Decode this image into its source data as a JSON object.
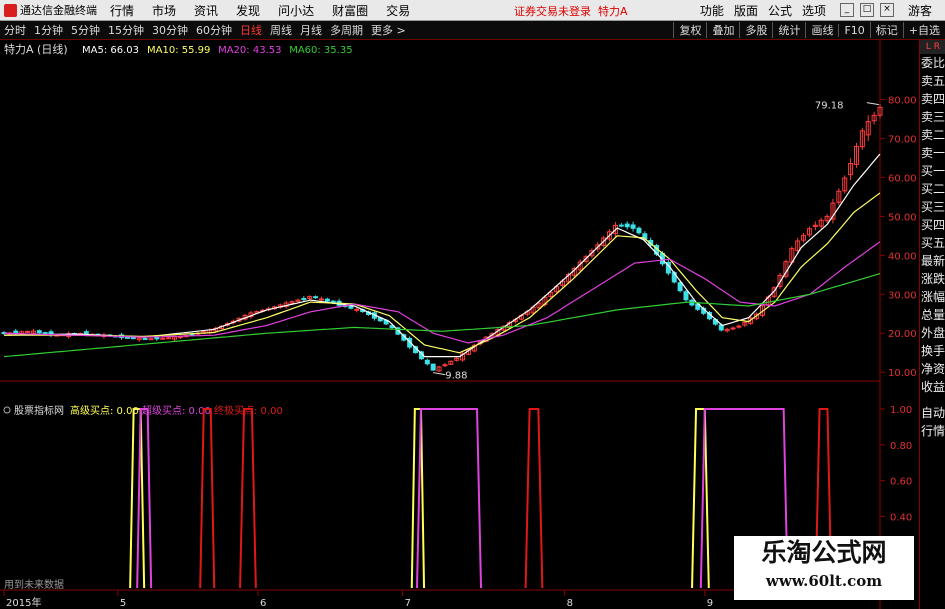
{
  "app": {
    "logo_text": "通达信金融终端",
    "menu": [
      "行情",
      "市场",
      "资讯",
      "发现",
      "问小达",
      "财富圈",
      "交易"
    ],
    "status_msg": "证券交易未登录",
    "stock_title": "特力A",
    "right_menu": [
      "功能",
      "版面",
      "公式",
      "选项"
    ],
    "guest_label": "游客",
    "win_controls": [
      "_",
      "□",
      "×"
    ]
  },
  "toolbar": {
    "periods": [
      "分时",
      "1分钟",
      "5分钟",
      "15分钟",
      "30分钟",
      "60分钟",
      "日线",
      "周线",
      "月线",
      "多周期",
      "更多 >"
    ],
    "active_period": "日线",
    "right_items": [
      "复权",
      "叠加",
      "多股",
      "统计",
      "画线",
      "F10",
      "标记",
      "+自选"
    ]
  },
  "side_tabs": [
    "L R",
    "委比",
    "卖五",
    "卖四",
    "卖三",
    "卖二",
    "卖一",
    "买一",
    "买二",
    "买三",
    "买四",
    "买五",
    "最新",
    "涨跌",
    "涨幅",
    "总量",
    "外盘",
    "换手",
    "净资",
    "收益"
  ],
  "side_tabs_bottom": [
    "自动",
    "行情"
  ],
  "watermark": {
    "title": "乐淘公式网",
    "url": "www.60lt.com"
  },
  "colors": {
    "up": "#ff3c3c",
    "down": "#3ce0e6",
    "ma5": "#ffffff",
    "ma10": "#ffff66",
    "ma20": "#e040e0",
    "ma60": "#33cc33",
    "high": "#ffff55",
    "super": "#dd44dd",
    "final": "#e01818",
    "axis": "#8a0000"
  },
  "chart_data": [
    {
      "type": "candlestick",
      "title": "特力A (日线)",
      "legend": [
        {
          "label": "MA5: 66.03",
          "color": "#ffffff"
        },
        {
          "label": "MA10: 55.99",
          "color": "#ffff66"
        },
        {
          "label": "MA20: 43.53",
          "color": "#e040e0"
        },
        {
          "label": "MA60: 35.35",
          "color": "#33cc33"
        }
      ],
      "ylim": [
        8,
        85
      ],
      "yticks": [
        10,
        20,
        30,
        40,
        50,
        60,
        70,
        80
      ],
      "ytick_labels": [
        "10.00",
        "20.00",
        "30.00",
        "40.00",
        "50.00",
        "60.00",
        "70.00",
        "80.00"
      ],
      "annotations": [
        {
          "label": "9.88",
          "value": 9.88,
          "pos": 0.49
        },
        {
          "label": "79.18",
          "value": 79.18,
          "pos": 0.985
        }
      ],
      "x_labels": [
        {
          "label": "2015年",
          "pos": 0.0
        },
        {
          "label": "5",
          "pos": 0.13
        },
        {
          "label": "6",
          "pos": 0.29
        },
        {
          "label": "7",
          "pos": 0.455
        },
        {
          "label": "8",
          "pos": 0.64
        },
        {
          "label": "9",
          "pos": 0.8
        }
      ],
      "price_path": [
        [
          0,
          20
        ],
        [
          0.03,
          20.5
        ],
        [
          0.06,
          19.5
        ],
        [
          0.09,
          20
        ],
        [
          0.12,
          19.3
        ],
        [
          0.16,
          18.5
        ],
        [
          0.2,
          19
        ],
        [
          0.24,
          21
        ],
        [
          0.28,
          25
        ],
        [
          0.32,
          27.5
        ],
        [
          0.35,
          29.5
        ],
        [
          0.38,
          27.5
        ],
        [
          0.41,
          25.5
        ],
        [
          0.44,
          22
        ],
        [
          0.47,
          15
        ],
        [
          0.49,
          10.5
        ],
        [
          0.52,
          14
        ],
        [
          0.55,
          19
        ],
        [
          0.58,
          23
        ],
        [
          0.61,
          27.5
        ],
        [
          0.64,
          34
        ],
        [
          0.67,
          41
        ],
        [
          0.7,
          48
        ],
        [
          0.72,
          47
        ],
        [
          0.74,
          42
        ],
        [
          0.76,
          35
        ],
        [
          0.78,
          28
        ],
        [
          0.8,
          25
        ],
        [
          0.82,
          20.5
        ],
        [
          0.84,
          22
        ],
        [
          0.86,
          25
        ],
        [
          0.88,
          32
        ],
        [
          0.9,
          42
        ],
        [
          0.92,
          47
        ],
        [
          0.94,
          50
        ],
        [
          0.96,
          60
        ],
        [
          0.98,
          72
        ],
        [
          1,
          78
        ]
      ],
      "ma_paths": {
        "ma5": [
          [
            0,
            19.5
          ],
          [
            0.08,
            19.8
          ],
          [
            0.16,
            19
          ],
          [
            0.24,
            21
          ],
          [
            0.3,
            26
          ],
          [
            0.35,
            28.5
          ],
          [
            0.4,
            27
          ],
          [
            0.44,
            23
          ],
          [
            0.48,
            14
          ],
          [
            0.52,
            14
          ],
          [
            0.56,
            20
          ],
          [
            0.6,
            26
          ],
          [
            0.65,
            36
          ],
          [
            0.7,
            47
          ],
          [
            0.73,
            44
          ],
          [
            0.76,
            37
          ],
          [
            0.79,
            28
          ],
          [
            0.82,
            22
          ],
          [
            0.85,
            24
          ],
          [
            0.88,
            31
          ],
          [
            0.91,
            42
          ],
          [
            0.94,
            48
          ],
          [
            0.97,
            58
          ],
          [
            1,
            66
          ]
        ],
        "ma10": [
          [
            0,
            19.5
          ],
          [
            0.08,
            19.5
          ],
          [
            0.16,
            19.2
          ],
          [
            0.24,
            20.2
          ],
          [
            0.3,
            24
          ],
          [
            0.35,
            28
          ],
          [
            0.4,
            27.5
          ],
          [
            0.44,
            24.5
          ],
          [
            0.48,
            17
          ],
          [
            0.52,
            15
          ],
          [
            0.56,
            19
          ],
          [
            0.6,
            24
          ],
          [
            0.65,
            34
          ],
          [
            0.7,
            45
          ],
          [
            0.73,
            44.5
          ],
          [
            0.76,
            39
          ],
          [
            0.79,
            31
          ],
          [
            0.82,
            24
          ],
          [
            0.85,
            23
          ],
          [
            0.88,
            28
          ],
          [
            0.91,
            37
          ],
          [
            0.94,
            43
          ],
          [
            0.97,
            51
          ],
          [
            1,
            56
          ]
        ],
        "ma20": [
          [
            0,
            20
          ],
          [
            0.08,
            19.5
          ],
          [
            0.16,
            19
          ],
          [
            0.24,
            19.5
          ],
          [
            0.3,
            22
          ],
          [
            0.35,
            25.5
          ],
          [
            0.4,
            27.5
          ],
          [
            0.45,
            25.5
          ],
          [
            0.49,
            20
          ],
          [
            0.53,
            17.5
          ],
          [
            0.57,
            19.5
          ],
          [
            0.62,
            24
          ],
          [
            0.67,
            31
          ],
          [
            0.72,
            38
          ],
          [
            0.76,
            39
          ],
          [
            0.8,
            34
          ],
          [
            0.84,
            28
          ],
          [
            0.88,
            27
          ],
          [
            0.92,
            30
          ],
          [
            0.96,
            37
          ],
          [
            1,
            43.5
          ]
        ],
        "ma60": [
          [
            0,
            14
          ],
          [
            0.1,
            16
          ],
          [
            0.2,
            18
          ],
          [
            0.3,
            20
          ],
          [
            0.4,
            21.5
          ],
          [
            0.5,
            20.5
          ],
          [
            0.6,
            22
          ],
          [
            0.7,
            26
          ],
          [
            0.78,
            28
          ],
          [
            0.85,
            27
          ],
          [
            0.92,
            30
          ],
          [
            1,
            35.3
          ]
        ]
      }
    },
    {
      "type": "line",
      "title": "股票指标网",
      "legend": [
        {
          "label": "高级买点: 0.00",
          "color": "#ffff55"
        },
        {
          "label": "超级买点: 0.00",
          "color": "#dd44dd"
        },
        {
          "label": "终极买点: 0.00",
          "color": "#e01818"
        }
      ],
      "ylim": [
        0,
        1.05
      ],
      "yticks": [
        0.4,
        0.6,
        0.8,
        1.0
      ],
      "ytick_labels": [
        "0.40",
        "0.60",
        "0.80",
        "1.00"
      ],
      "footer_label": "用到未来数据",
      "series": [
        {
          "name": "高级买点",
          "color": "#ffff55",
          "pulses": [
            [
              0.148,
              0.156
            ],
            [
              0.469,
              0.476
            ],
            [
              0.79,
              0.8
            ]
          ]
        },
        {
          "name": "超级买点",
          "color": "#dd44dd",
          "pulses": [
            [
              0.156,
              0.164
            ],
            [
              0.476,
              0.54
            ],
            [
              0.8,
              0.89
            ]
          ]
        },
        {
          "name": "终极买点",
          "color": "#e01818",
          "pulses": [
            [
              0.228,
              0.236
            ],
            [
              0.274,
              0.283
            ],
            [
              0.6,
              0.61
            ],
            [
              0.931,
              0.94
            ]
          ]
        }
      ]
    }
  ]
}
